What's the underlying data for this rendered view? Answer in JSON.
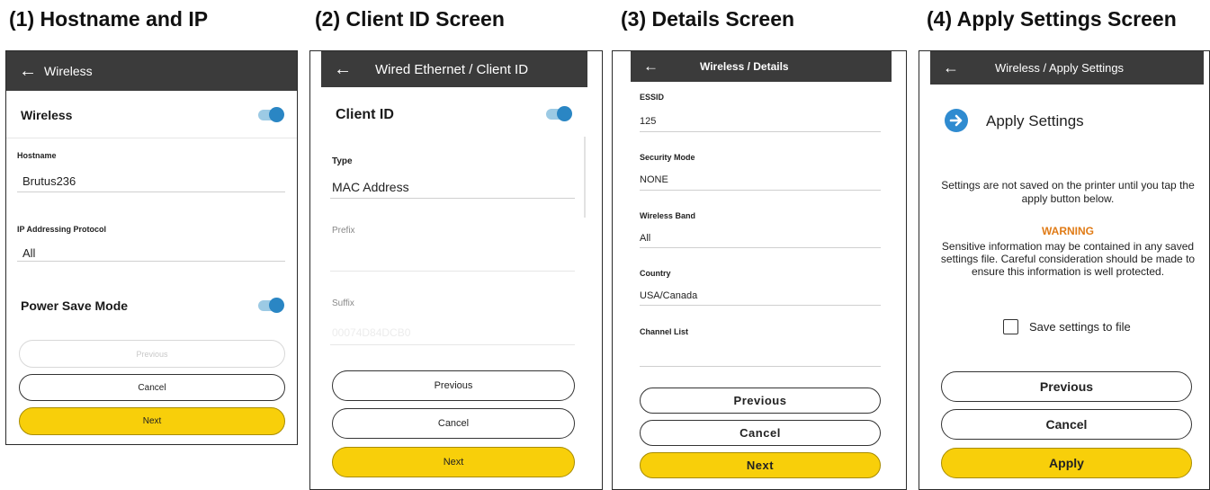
{
  "headings": [
    "(1) Hostname and IP",
    "(2) Client ID Screen",
    "(3) Details Screen",
    "(4) Apply Settings Screen"
  ],
  "colors": {
    "appbar": "#3b3b3b",
    "accent_toggle": "#2a86c4",
    "primary_button": "#f8cf0a",
    "warning": "#e07b16",
    "arrow_circle": "#2f8bd0"
  },
  "icons": {
    "back": "arrow-left-icon",
    "apply": "arrow-right-circle-icon",
    "checkbox": "checkbox-icon"
  },
  "screen1": {
    "title": "Wireless",
    "wireless_label": "Wireless",
    "hostname_label": "Hostname",
    "hostname_value": "Brutus236",
    "ip_label": "IP Addressing Protocol",
    "ip_value": "All",
    "power_label": "Power Save Mode",
    "previous": "Previous",
    "cancel": "Cancel",
    "next": "Next"
  },
  "screen2": {
    "title": "Wired Ethernet / Client ID",
    "client_id_label": "Client ID",
    "type_label": "Type",
    "type_value": "MAC Address",
    "prefix_label": "Prefix",
    "suffix_label": "Suffix",
    "suffix_placeholder": "00074D84DCB0",
    "previous": "Previous",
    "cancel": "Cancel",
    "next": "Next"
  },
  "screen3": {
    "title": "Wireless / Details",
    "essid_label": "ESSID",
    "essid_value": "125",
    "security_label": "Security Mode",
    "security_value": "NONE",
    "band_label": "Wireless Band",
    "band_value": "All",
    "country_label": "Country",
    "country_value": "USA/Canada",
    "channel_label": "Channel List",
    "previous": "Previous",
    "cancel": "Cancel",
    "next": "Next"
  },
  "screen4": {
    "title": "Wireless / Apply Settings",
    "heading": "Apply Settings",
    "info": "Settings are not saved on the printer until you tap the apply button below.",
    "warning_title": "WARNING",
    "warning_text": "Sensitive information may be contained in any saved settings file. Careful consideration should be made to ensure this information is well protected.",
    "checkbox_label": "Save settings to file",
    "previous": "Previous",
    "cancel": "Cancel",
    "apply": "Apply"
  }
}
